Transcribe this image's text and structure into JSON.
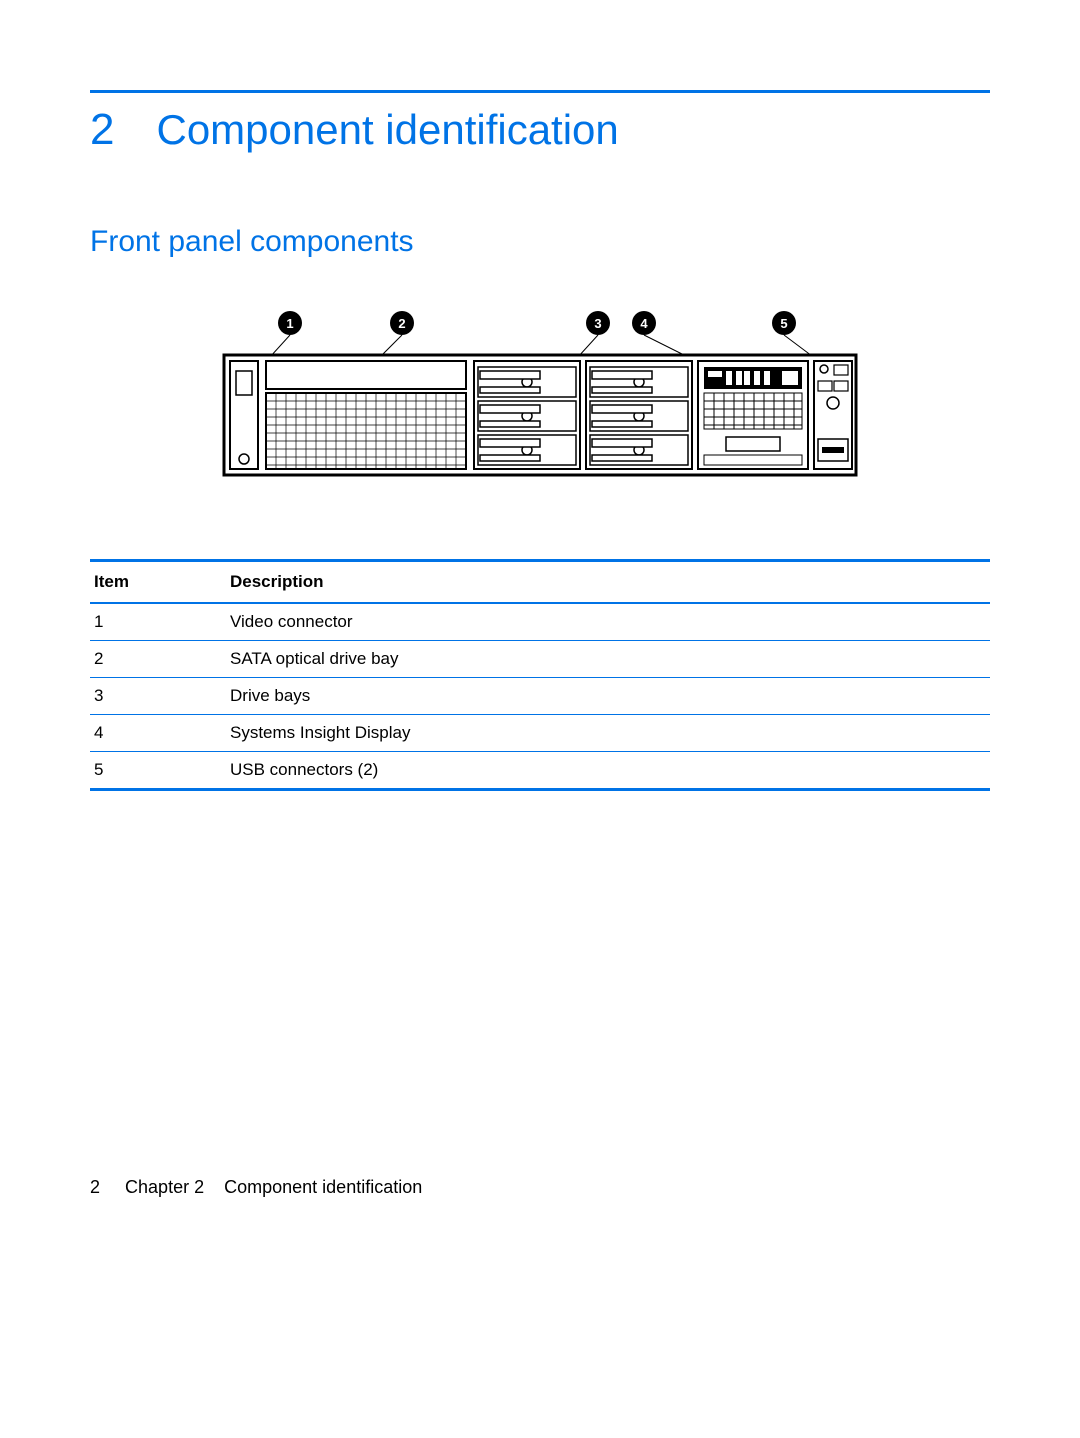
{
  "chapter": {
    "number": "2",
    "title": "Component identification"
  },
  "section": {
    "title": "Front panel components"
  },
  "callouts": [
    "1",
    "2",
    "3",
    "4",
    "5"
  ],
  "table": {
    "headers": {
      "item": "Item",
      "description": "Description"
    },
    "rows": [
      {
        "item": "1",
        "description": "Video connector"
      },
      {
        "item": "2",
        "description": "SATA optical drive bay"
      },
      {
        "item": "3",
        "description": "Drive bays"
      },
      {
        "item": "4",
        "description": "Systems Insight Display"
      },
      {
        "item": "5",
        "description": "USB connectors (2)"
      }
    ]
  },
  "footer": {
    "page": "2",
    "chapterLabel": "Chapter 2",
    "chapterTitle": "Component identification"
  }
}
